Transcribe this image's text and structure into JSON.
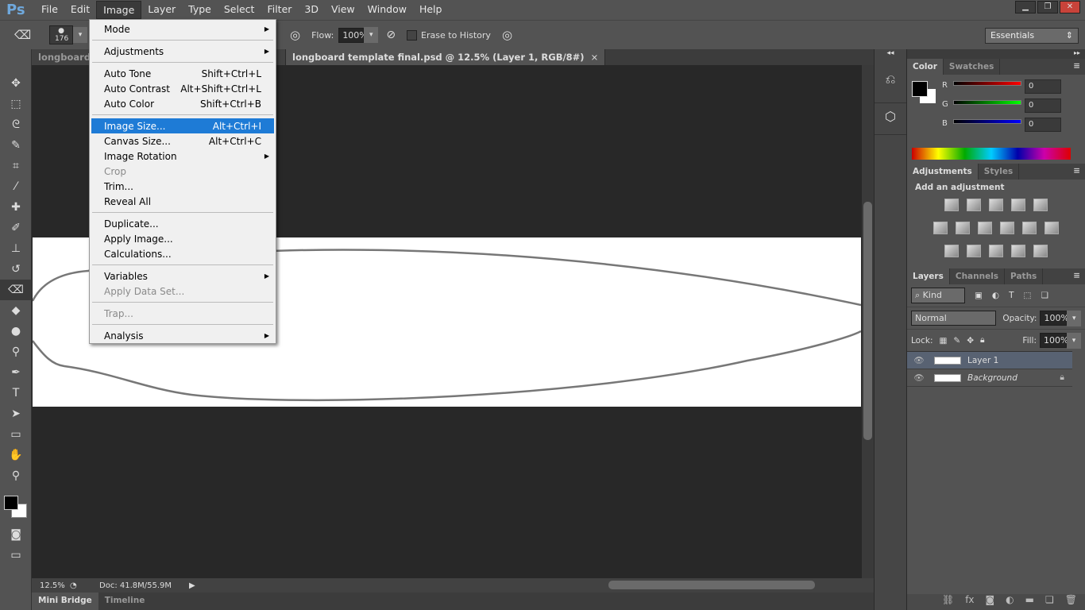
{
  "app": {
    "logo": "Ps"
  },
  "menubar": [
    "File",
    "Edit",
    "Image",
    "Layer",
    "Type",
    "Select",
    "Filter",
    "3D",
    "View",
    "Window",
    "Help"
  ],
  "window_controls": [
    "minimize",
    "restore",
    "close"
  ],
  "options": {
    "brush_size": "176",
    "flow_label": "Flow:",
    "flow_value": "100%",
    "erase_to_history": "Erase to History",
    "workspace": "Essentials"
  },
  "tabs": [
    {
      "label": "longboard t",
      "active": false
    },
    {
      "label": "longboard template final.psd @ 12.5% (Layer 1, RGB/8#)",
      "active": true
    }
  ],
  "image_menu": [
    {
      "label": "Mode",
      "submenu": true
    },
    "sep",
    {
      "label": "Adjustments",
      "submenu": true
    },
    "sep",
    {
      "label": "Auto Tone",
      "shortcut": "Shift+Ctrl+L"
    },
    {
      "label": "Auto Contrast",
      "shortcut": "Alt+Shift+Ctrl+L"
    },
    {
      "label": "Auto Color",
      "shortcut": "Shift+Ctrl+B"
    },
    "sep",
    {
      "label": "Image Size...",
      "shortcut": "Alt+Ctrl+I",
      "highlighted": true
    },
    {
      "label": "Canvas Size...",
      "shortcut": "Alt+Ctrl+C"
    },
    {
      "label": "Image Rotation",
      "submenu": true
    },
    {
      "label": "Crop",
      "disabled": true
    },
    {
      "label": "Trim..."
    },
    {
      "label": "Reveal All"
    },
    "sep",
    {
      "label": "Duplicate..."
    },
    {
      "label": "Apply Image..."
    },
    {
      "label": "Calculations..."
    },
    "sep",
    {
      "label": "Variables",
      "submenu": true
    },
    {
      "label": "Apply Data Set...",
      "disabled": true
    },
    "sep",
    {
      "label": "Trap...",
      "disabled": true
    },
    "sep",
    {
      "label": "Analysis",
      "submenu": true
    }
  ],
  "status": {
    "zoom": "12.5%",
    "doc": "Doc: 41.8M/55.9M"
  },
  "bottom_tabs": [
    "Mini Bridge",
    "Timeline"
  ],
  "color_panel": {
    "tabs": [
      "Color",
      "Swatches"
    ],
    "channels": [
      {
        "label": "R",
        "value": "0",
        "color": "#ff0000"
      },
      {
        "label": "G",
        "value": "0",
        "color": "#00ff00"
      },
      {
        "label": "B",
        "value": "0",
        "color": "#0000ff"
      }
    ]
  },
  "adjustments_panel": {
    "tabs": [
      "Adjustments",
      "Styles"
    ],
    "heading": "Add an adjustment"
  },
  "layers_panel": {
    "tabs": [
      "Layers",
      "Channels",
      "Paths"
    ],
    "filter": "Kind",
    "blend_mode": "Normal",
    "opacity_label": "Opacity:",
    "opacity": "100%",
    "lock_label": "Lock:",
    "fill_label": "Fill:",
    "fill": "100%",
    "layers": [
      {
        "name": "Layer 1",
        "selected": true
      },
      {
        "name": "Background",
        "locked": true
      }
    ]
  }
}
